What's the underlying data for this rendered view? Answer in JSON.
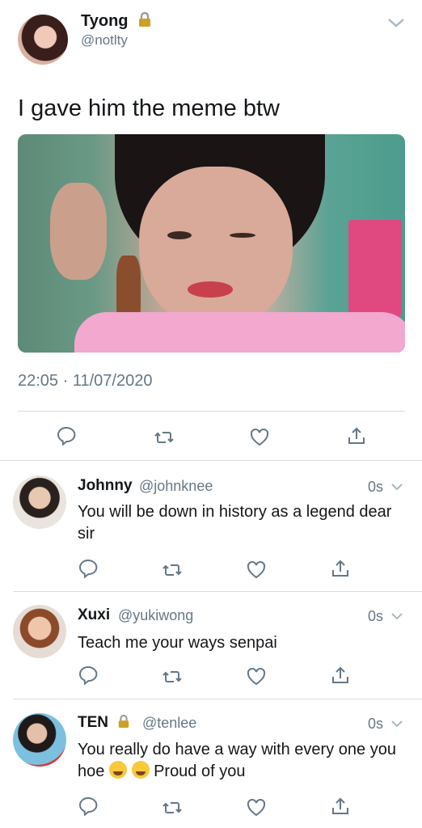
{
  "tweet": {
    "author_name": "Tyong",
    "author_handle": "@notlty",
    "text": "I gave him the meme btw",
    "timestamp": "22:05 · 11/07/2020"
  },
  "replies": [
    {
      "name": "Johnny",
      "handle": "@johnknee",
      "time": "0s",
      "text": "You will be down in history as a legend dear sir",
      "locked": false
    },
    {
      "name": "Xuxi",
      "handle": "@yukiwong",
      "time": "0s",
      "text": "Teach me your ways senpai",
      "locked": false
    },
    {
      "name": "TEN",
      "handle": "@tenlee",
      "time": "0s",
      "text_before": "You really do have a way with every one you hoe",
      "text_after": "Proud of you",
      "locked": true
    }
  ],
  "icons": [
    "lock-icon",
    "chevron-down-icon",
    "reply-icon",
    "retweet-icon",
    "like-icon",
    "share-icon",
    "loudly-crying-face-emoji"
  ],
  "colors": {
    "text": "#14171a",
    "secondary": "#657786",
    "divider": "#d8dde2",
    "lock": "#c9a227"
  }
}
